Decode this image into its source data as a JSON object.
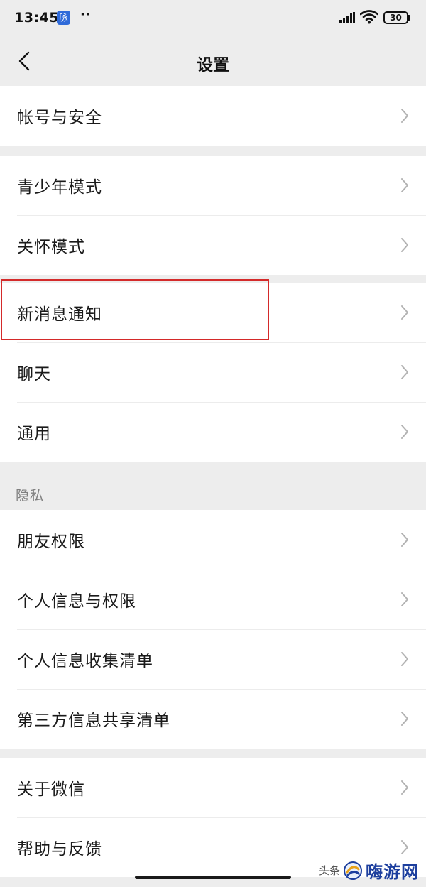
{
  "status_bar": {
    "time": "13:45",
    "app_badge": "脉",
    "dots": "··",
    "battery_level": "30"
  },
  "nav": {
    "title": "设置"
  },
  "groups": [
    {
      "items": [
        {
          "label": "帐号与安全"
        }
      ]
    },
    {
      "items": [
        {
          "label": "青少年模式"
        },
        {
          "label": "关怀模式"
        }
      ]
    },
    {
      "items": [
        {
          "label": "新消息通知",
          "highlighted": true
        },
        {
          "label": "聊天"
        },
        {
          "label": "通用"
        }
      ]
    },
    {
      "section_label": "隐私",
      "items": [
        {
          "label": "朋友权限"
        },
        {
          "label": "个人信息与权限"
        },
        {
          "label": "个人信息收集清单"
        },
        {
          "label": "第三方信息共享清单"
        }
      ]
    },
    {
      "items": [
        {
          "label": "关于微信"
        },
        {
          "label": "帮助与反馈"
        }
      ]
    }
  ],
  "watermark": {
    "prefix": "头条",
    "site": "嗨游网"
  },
  "colors": {
    "background": "#ededed",
    "row_background": "#ffffff",
    "highlight_border": "#d42a2a",
    "watermark_text": "#1d3f9e"
  }
}
